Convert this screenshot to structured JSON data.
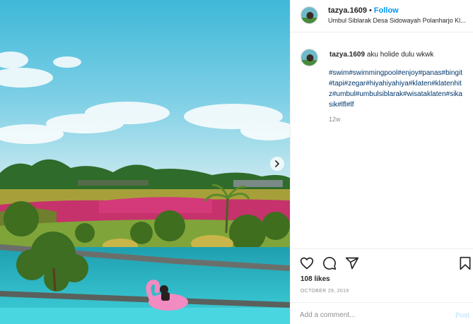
{
  "post": {
    "username": "tazya.1609",
    "separator": "•",
    "follow_label": "Follow",
    "location": "Umbul Siblarak Desa Sidowayah Polanharjo Kl...",
    "caption_text": "aku holide dulu wkwk",
    "hashtags": "#swim#swimmingpool#enjoy#panas#bingit#tapi#zegar#hiyahiyahiya#klaten#klatenhitz#umbul#umbulsiblarak#wisataklaten#sikasik#lfl#lf",
    "time_ago": "12w",
    "likes": "108 likes",
    "date": "OCTOBER 29, 2019"
  },
  "icons": {
    "next": "chevron-right-icon",
    "like": "heart-icon",
    "comment": "comment-icon",
    "share": "paper-plane-icon",
    "save": "bookmark-icon"
  },
  "comment": {
    "placeholder": "Add a comment...",
    "post_label": "Post"
  },
  "colors": {
    "link": "#00376b",
    "follow": "#0095f6",
    "muted": "#8e8e8e",
    "post_disabled": "#b2dffc"
  }
}
